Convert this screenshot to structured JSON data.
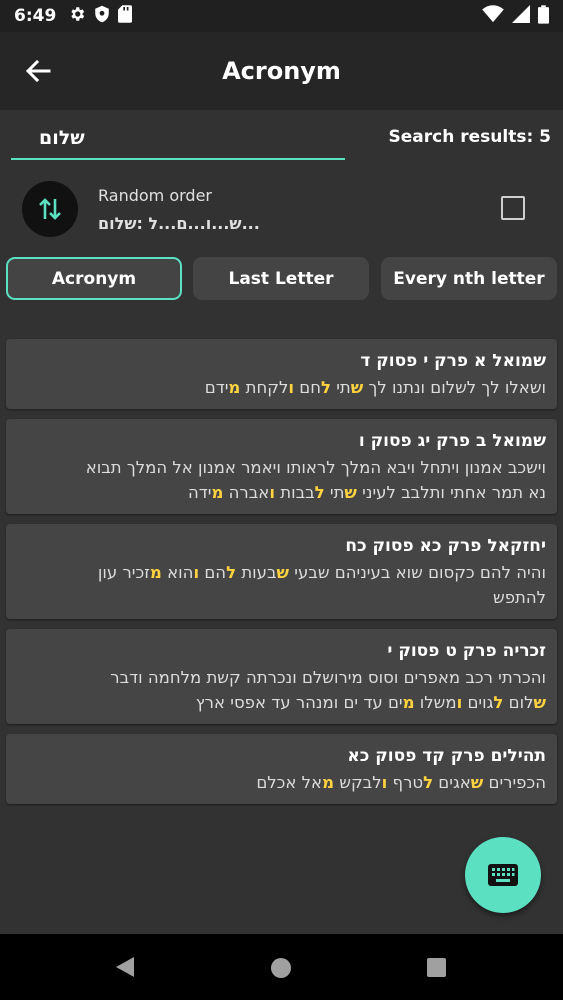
{
  "status": {
    "time": "6:49",
    "left_icons": [
      "gear-icon",
      "shield-icon",
      "sd-card-icon"
    ],
    "right_icons": [
      "wifi-icon",
      "signal-icon",
      "battery-icon"
    ]
  },
  "header": {
    "title": "Acronym",
    "back_icon": "arrow-back-icon"
  },
  "search": {
    "value": "שלום",
    "results_label": "Search results: 5"
  },
  "option": {
    "icon": "swap-vertical-icon",
    "title": "Random order",
    "subtitle": "ש...ו...ם...ל :שלום..."
  },
  "tabs": [
    {
      "label": "Acronym",
      "active": true
    },
    {
      "label": "Last Letter",
      "active": false
    },
    {
      "label": "Every nth letter",
      "active": false
    }
  ],
  "results": [
    {
      "title": "שמואל א פרק י פסוק ד",
      "lines": [
        [
          [
            "ושאלו לך לשלום ונתנו לך ",
            false
          ],
          [
            "ש",
            true
          ],
          [
            "תי ",
            false
          ],
          [
            "ל",
            true
          ],
          [
            "חם ",
            false
          ],
          [
            "ו",
            true
          ],
          [
            "לקחת ",
            false
          ],
          [
            "מ",
            true
          ],
          [
            "ידם",
            false
          ]
        ]
      ]
    },
    {
      "title": "שמואל ב פרק יג פסוק ו",
      "lines": [
        [
          [
            "וישכב אמנון ויתחל ויבא המלך לראותו ויאמר אמנון אל המלך תבוא",
            false
          ]
        ],
        [
          [
            "נא תמר אחתי ותלבב לעיני ",
            false
          ],
          [
            "ש",
            true
          ],
          [
            "תי ",
            false
          ],
          [
            "ל",
            true
          ],
          [
            "בבות ",
            false
          ],
          [
            "ו",
            true
          ],
          [
            "אברה ",
            false
          ],
          [
            "מ",
            true
          ],
          [
            "ידה",
            false
          ]
        ]
      ]
    },
    {
      "title": "יחזקאל פרק כא פסוק כח",
      "lines": [
        [
          [
            "והיה להם כקסום שוא בעיניהם שבעי ",
            false
          ],
          [
            "ש",
            true
          ],
          [
            "בעות ",
            false
          ],
          [
            "ל",
            true
          ],
          [
            "הם ",
            false
          ],
          [
            "ו",
            true
          ],
          [
            "הוא ",
            false
          ],
          [
            "מ",
            true
          ],
          [
            "זכיר עון",
            false
          ]
        ],
        [
          [
            "להתפש",
            false
          ]
        ]
      ]
    },
    {
      "title": "זכריה פרק ט פסוק י",
      "lines": [
        [
          [
            "והכרתי רכב מאפרים וסוס מירושלם ונכרתה קשת מלחמה ודבר",
            false
          ]
        ],
        [
          [
            "ש",
            true
          ],
          [
            "לום ",
            false
          ],
          [
            "ל",
            true
          ],
          [
            "גוים ",
            false
          ],
          [
            "ו",
            true
          ],
          [
            "משלו ",
            false
          ],
          [
            "מ",
            true
          ],
          [
            "ים עד ים ומנהר עד אפסי ארץ",
            false
          ]
        ]
      ]
    },
    {
      "title": "תהילים פרק קד פסוק כא",
      "lines": [
        [
          [
            "הכפירים ",
            false
          ],
          [
            "ש",
            true
          ],
          [
            "אגים ",
            false
          ],
          [
            "ל",
            true
          ],
          [
            "טרף ",
            false
          ],
          [
            "ו",
            true
          ],
          [
            "לבקש ",
            false
          ],
          [
            "מ",
            true
          ],
          [
            "אל אכלם",
            false
          ]
        ]
      ]
    }
  ],
  "fab": {
    "icon": "keyboard-icon"
  },
  "nav": {
    "icons": [
      "nav-back-icon",
      "nav-home-icon",
      "nav-recents-icon"
    ]
  },
  "colors": {
    "accent": "#5ce0c2",
    "highlight": "#ffd23f",
    "background": "#323232",
    "card": "#454545"
  }
}
